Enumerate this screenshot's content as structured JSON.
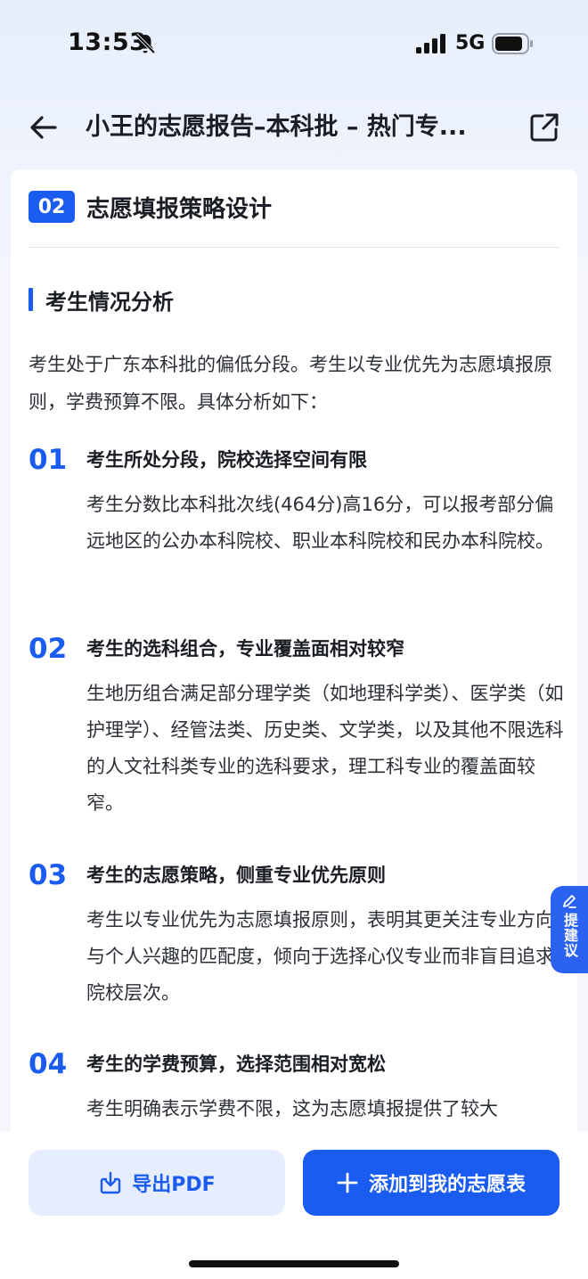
{
  "status_bar": {
    "time": "13:53",
    "network": "5G",
    "icons": [
      "bell-slash-icon",
      "signal-icon",
      "battery-icon"
    ]
  },
  "header": {
    "title": "小王的志愿报告–本科批 – 热门专...",
    "icons": [
      "back-arrow-icon",
      "share-icon"
    ]
  },
  "section": {
    "badge": "02",
    "title": "志愿填报策略设计"
  },
  "subsection": {
    "title": "考生情况分析"
  },
  "intro": "考生处于广东本科批的偏低分段。考生以专业优先为志愿填报原则，学费预算不限。具体分析如下：",
  "points": [
    {
      "num": "01",
      "title": "考生所处分段，院校选择空间有限",
      "body": "考生分数比本科批次线(464分)高16分，可以报考部分偏远地区的公办本科院校、职业本科院校和民办本科院校。"
    },
    {
      "num": "02",
      "title": "考生的选科组合，专业覆盖面相对较窄",
      "body": "生地历组合满足部分理学类（如地理科学类）、医学类（如护理学）、经管法类、历史类、文学类，以及其他不限选科的人文社科类专业的选科要求，理工科专业的覆盖面较窄。"
    },
    {
      "num": "03",
      "title": "考生的志愿策略，侧重专业优先原则",
      "body": "考生以专业优先为志愿填报原则，表明其更关注专业方向与个人兴趣的匹配度，倾向于选择心仪专业而非盲目追求院校层次。"
    },
    {
      "num": "04",
      "title": "考生的学费预算，选择范围相对宽松",
      "body": "考生明确表示学费不限，这为志愿填报提供了较大"
    }
  ],
  "suggest_tab": {
    "label": "提建议"
  },
  "bottom": {
    "export_label": "导出PDF",
    "add_label": "添加到我的志愿表"
  },
  "colors": {
    "accent": "#1a5cf0",
    "export_bg": "#e6edfd",
    "text": "#1a1d23"
  }
}
